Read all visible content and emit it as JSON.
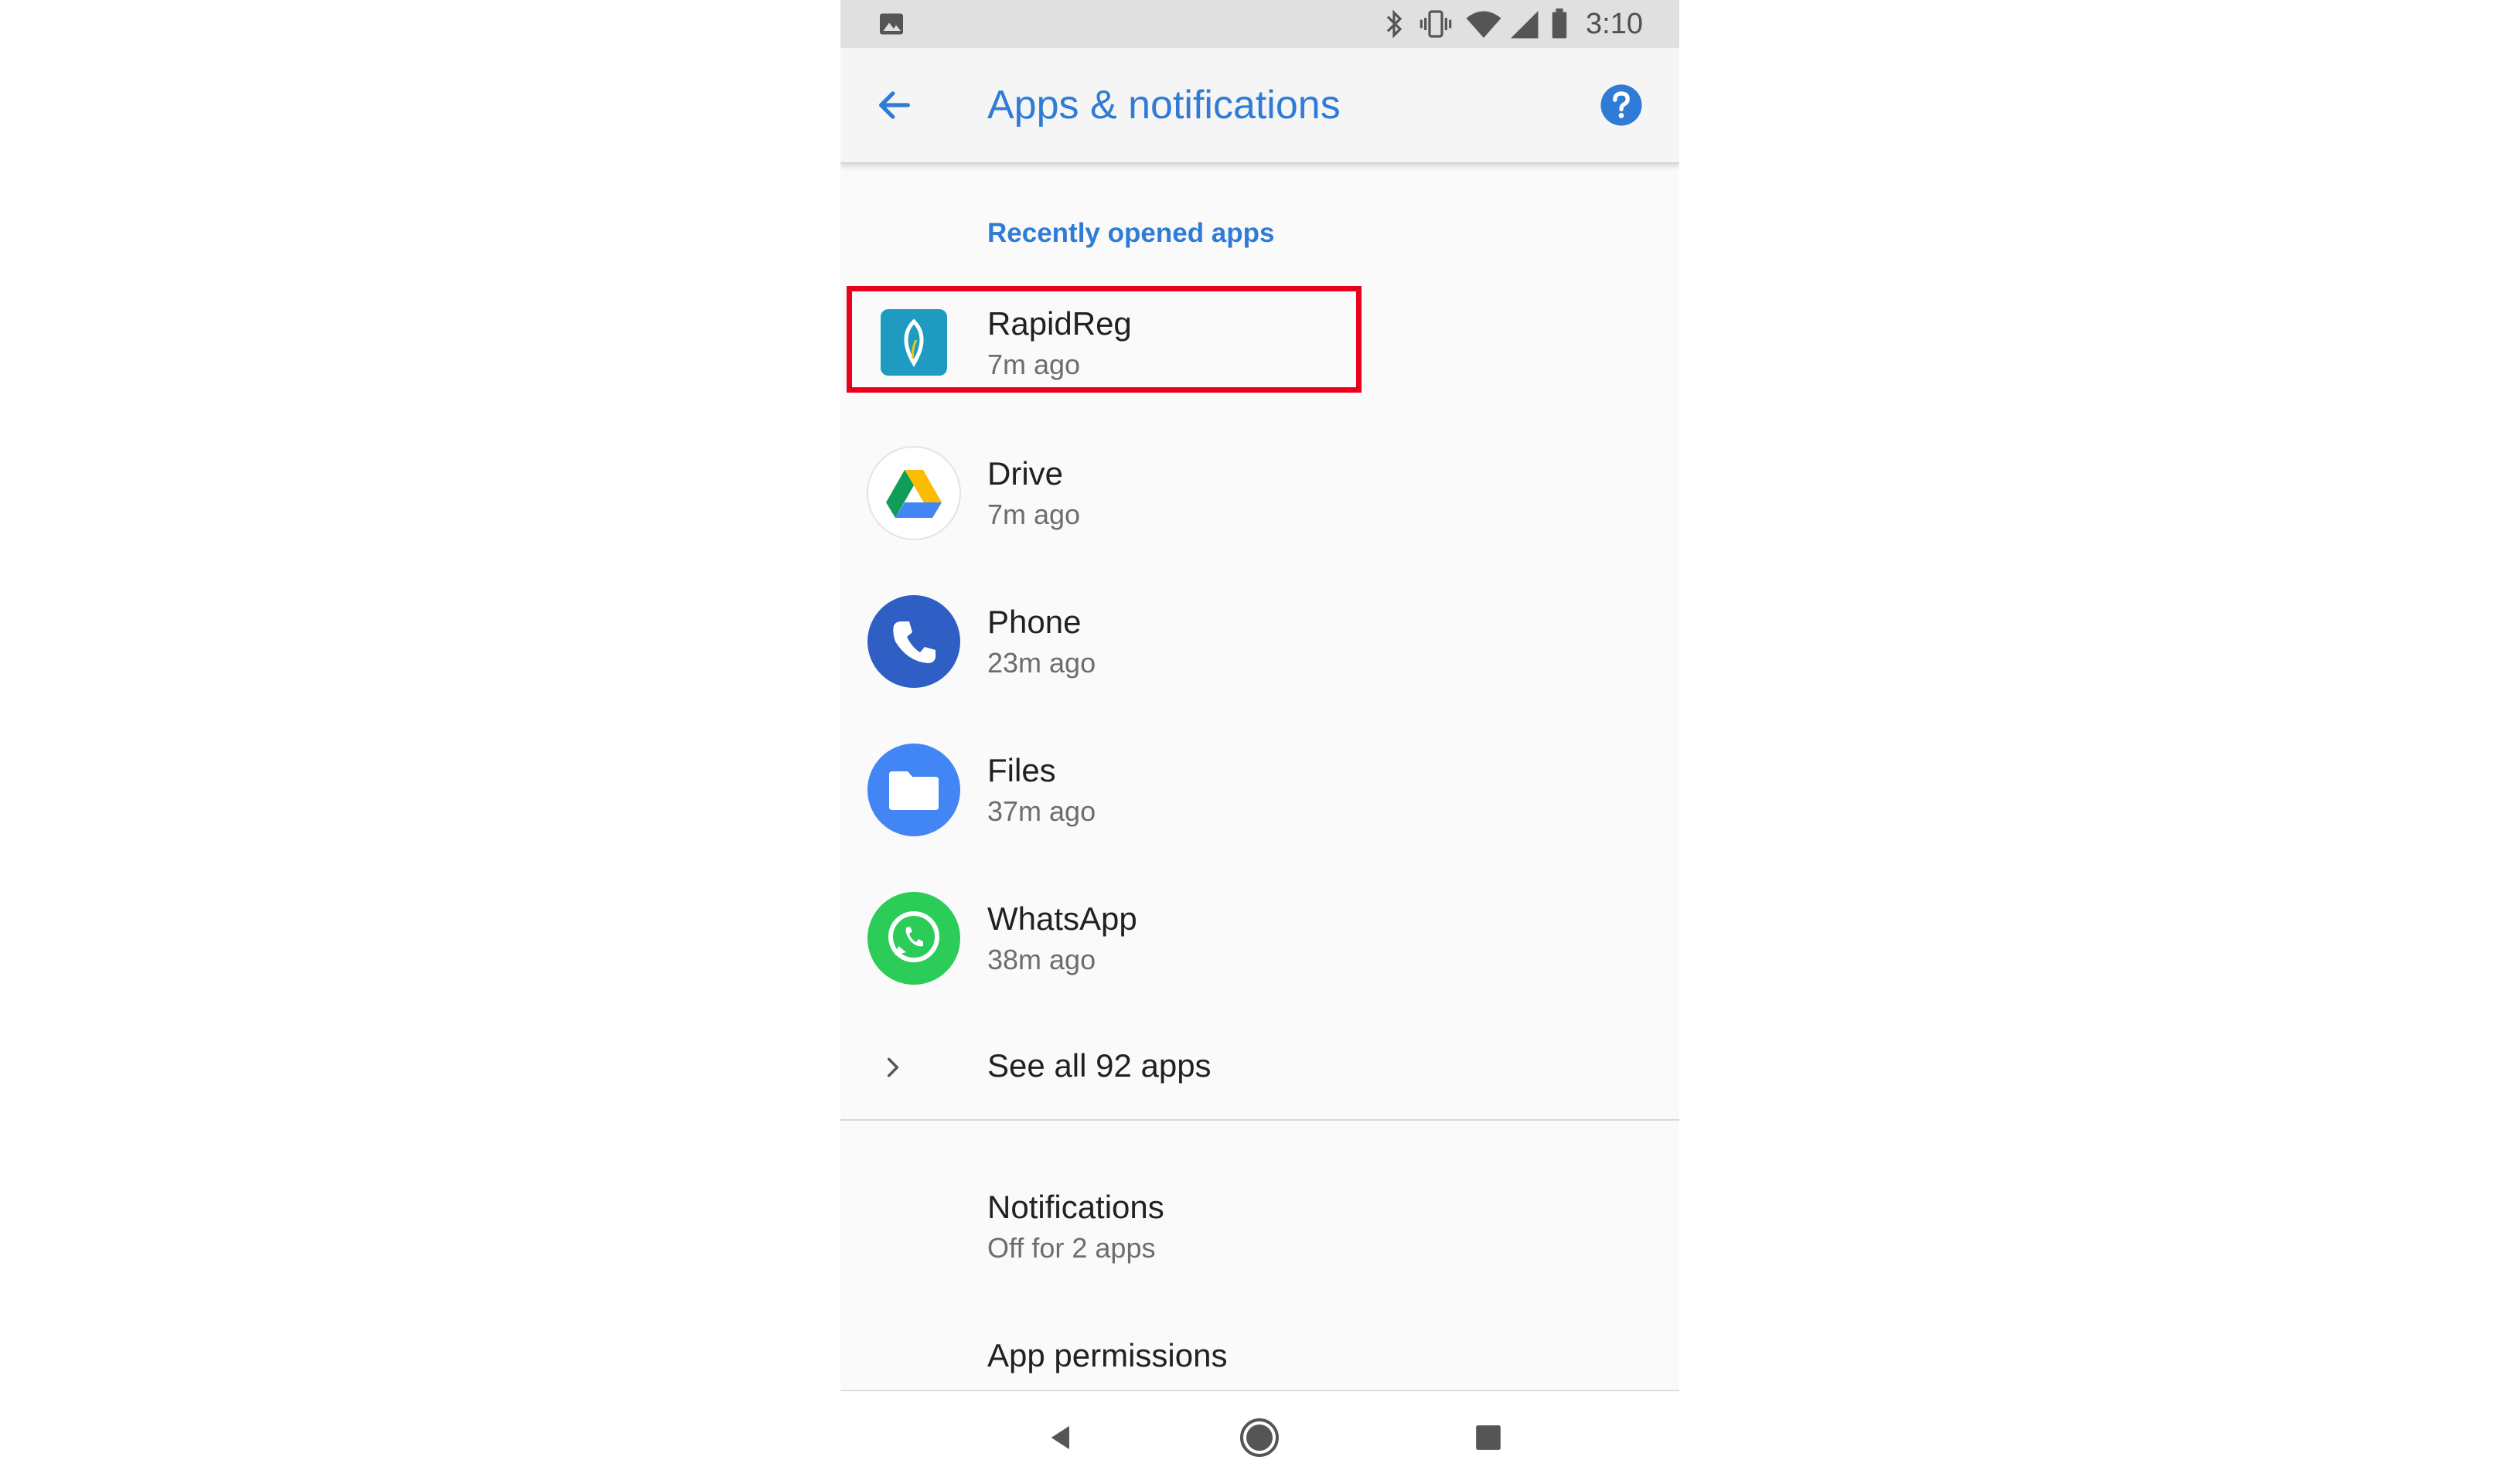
{
  "status_bar": {
    "time": "3:10",
    "left_icons": [
      "image-icon"
    ],
    "right_icons": [
      "bluetooth-icon",
      "vibrate-icon",
      "wifi-icon",
      "signal-icon",
      "battery-icon"
    ]
  },
  "app_bar": {
    "title": "Apps & notifications",
    "back_icon": "arrow-back-icon",
    "help_icon": "help-icon"
  },
  "recent": {
    "header": "Recently opened apps",
    "apps": [
      {
        "name": "RapidReg",
        "time": "7m ago",
        "icon": "rapidreg-icon"
      },
      {
        "name": "Drive",
        "time": "7m ago",
        "icon": "drive-icon"
      },
      {
        "name": "Phone",
        "time": "23m ago",
        "icon": "phone-icon"
      },
      {
        "name": "Files",
        "time": "37m ago",
        "icon": "files-icon"
      },
      {
        "name": "WhatsApp",
        "time": "38m ago",
        "icon": "whatsapp-icon"
      }
    ],
    "see_all": "See all 92 apps"
  },
  "settings": [
    {
      "title": "Notifications",
      "subtitle": "Off for 2 apps"
    },
    {
      "title": "App permissions",
      "subtitle": ""
    }
  ],
  "nav_bar": {
    "back": "nav-back-icon",
    "home": "nav-home-icon",
    "recents": "nav-recents-icon"
  },
  "colors": {
    "accent": "#2f7bd6",
    "highlight": "#e8001c",
    "status_bar": "#e0e0e0",
    "background": "#fafafa"
  }
}
